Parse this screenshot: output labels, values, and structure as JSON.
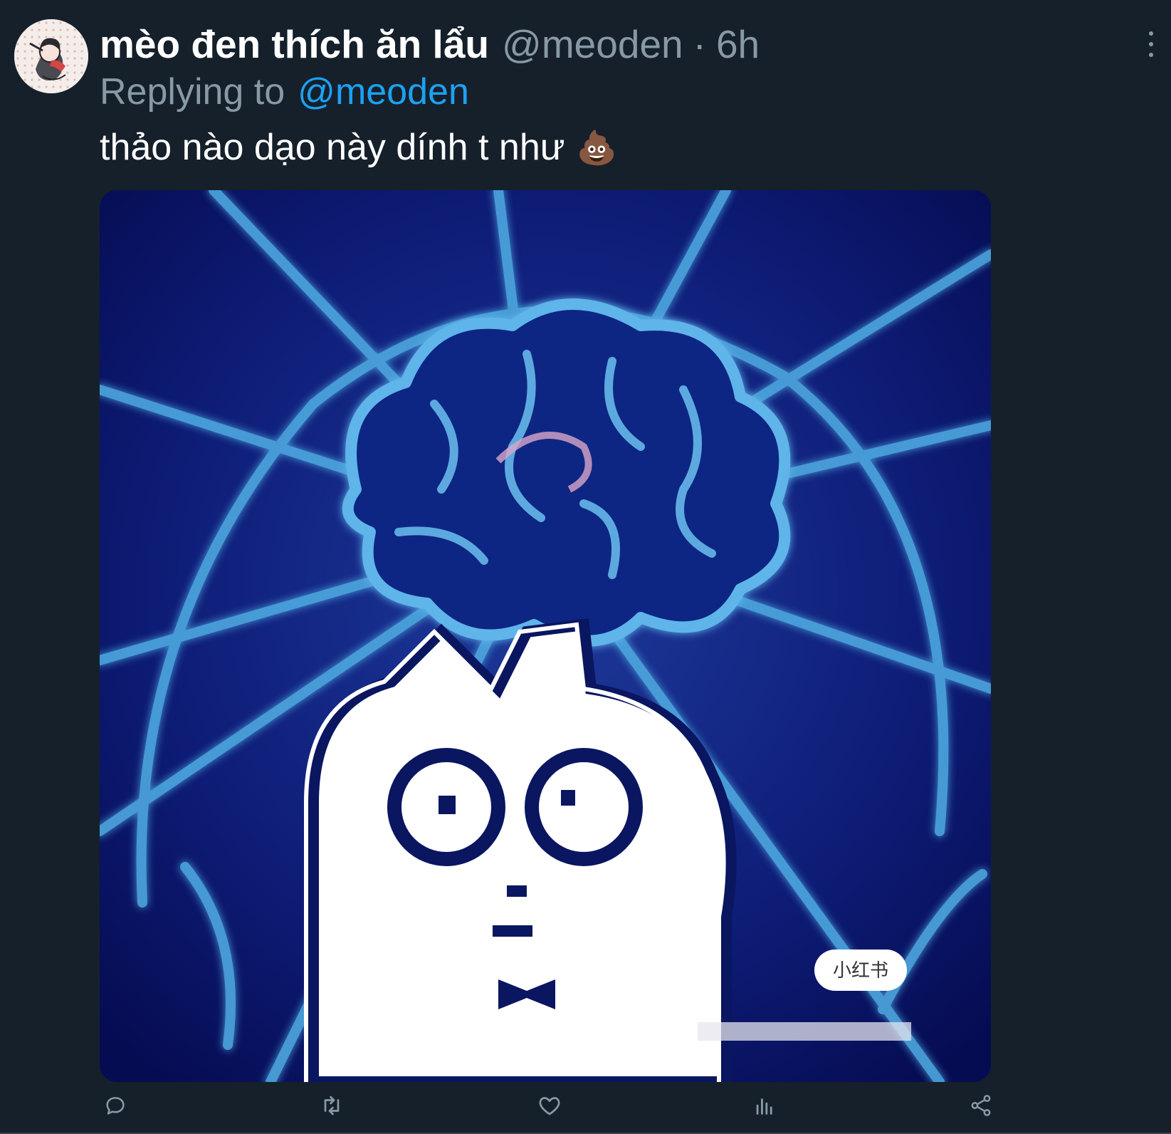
{
  "tweet": {
    "author": {
      "display_name": "mèo đen thích ăn lẩu",
      "handle": "@meoden",
      "avatar": "avatar-image"
    },
    "separator": "·",
    "time": "6h",
    "reply": {
      "prefix": "Replying to",
      "handle": "@meoden"
    },
    "text": "thảo nào dạo này dính t như",
    "emoji": "💩",
    "media": {
      "description_icon": "image",
      "watermark": "小红书"
    },
    "actions": [
      {
        "name": "reply",
        "icon": "reply-icon"
      },
      {
        "name": "retweet",
        "icon": "retweet-icon"
      },
      {
        "name": "like",
        "icon": "like-icon"
      },
      {
        "name": "analytics",
        "icon": "analytics-icon"
      },
      {
        "name": "share",
        "icon": "share-icon"
      }
    ]
  },
  "colors": {
    "background": "#15202b",
    "secondary_text": "#8899a6",
    "accent": "#1da1f2",
    "border": "#38444d"
  }
}
